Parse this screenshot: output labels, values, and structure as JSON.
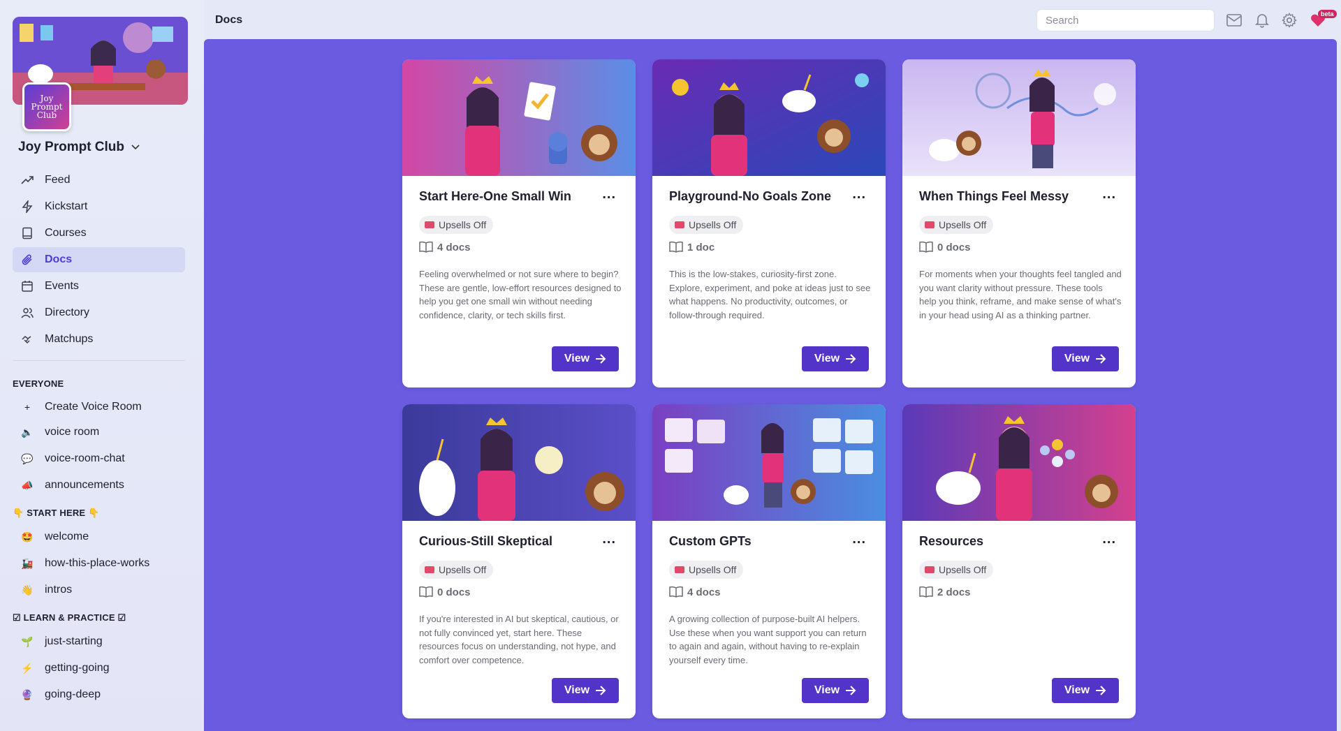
{
  "header": {
    "page_title": "Docs",
    "search_placeholder": "Search",
    "beta_badge": "beta"
  },
  "club": {
    "name": "Joy Prompt Club",
    "logo_text": "Joy Prompt Club"
  },
  "nav": [
    {
      "label": "Feed",
      "icon": "trending-icon"
    },
    {
      "label": "Kickstart",
      "icon": "lightning-icon"
    },
    {
      "label": "Courses",
      "icon": "book-icon"
    },
    {
      "label": "Docs",
      "icon": "paperclip-icon",
      "active": true
    },
    {
      "label": "Events",
      "icon": "calendar-icon"
    },
    {
      "label": "Directory",
      "icon": "users-icon"
    },
    {
      "label": "Matchups",
      "icon": "handshake-icon"
    }
  ],
  "sections": {
    "everyone": "EVERYONE",
    "start_here": "START HERE",
    "learn_practice": "LEARN & PRACTICE"
  },
  "everyone_channels": [
    {
      "label": "Create Voice Room",
      "icon": "+"
    },
    {
      "label": "voice room",
      "icon": "🔈"
    },
    {
      "label": "voice-room-chat",
      "icon": "💬"
    },
    {
      "label": "announcements",
      "icon": "📣"
    }
  ],
  "start_channels": [
    {
      "label": "welcome",
      "icon": "🤩"
    },
    {
      "label": "how-this-place-works",
      "icon": "🚂"
    },
    {
      "label": "intros",
      "icon": "👋"
    }
  ],
  "learn_channels": [
    {
      "label": "just-starting",
      "icon": "🌱"
    },
    {
      "label": "getting-going",
      "icon": "⚡"
    },
    {
      "label": "going-deep",
      "icon": "🔮"
    }
  ],
  "cards": [
    {
      "title": "Start Here-One Small Win",
      "badge": "Upsells Off",
      "docs": "4 docs",
      "desc": "Feeling overwhelmed or not sure where to begin? These are gentle, low-effort resources designed to help you get one small win without needing confidence, clarity, or tech skills first.",
      "view": "View"
    },
    {
      "title": "Playground-No Goals Zone",
      "badge": "Upsells Off",
      "docs": "1 doc",
      "desc": "This is the low-stakes, curiosity-first zone. Explore, experiment, and poke at ideas just to see what happens. No productivity, outcomes, or follow-through required.",
      "view": "View"
    },
    {
      "title": "When Things Feel Messy",
      "badge": "Upsells Off",
      "docs": "0 docs",
      "desc": "For moments when your thoughts feel tangled and you want clarity without pressure. These tools help you think, reframe, and make sense of what's in your head using AI as a thinking partner.",
      "view": "View"
    },
    {
      "title": "Curious-Still Skeptical",
      "badge": "Upsells Off",
      "docs": "0 docs",
      "desc": "If you're interested in AI but skeptical, cautious, or not fully convinced yet, start here. These resources focus on understanding, not hype, and comfort over competence.",
      "view": "View"
    },
    {
      "title": "Custom GPTs",
      "badge": "Upsells Off",
      "docs": "4 docs",
      "desc": "A growing collection of purpose-built AI helpers. Use these when you want support you can return to again and again, without having to re-explain yourself every time.",
      "view": "View"
    },
    {
      "title": "Resources",
      "badge": "Upsells Off",
      "docs": "2 docs",
      "desc": "",
      "view": "View"
    }
  ],
  "colors": {
    "main_bg": "#6a5be0",
    "button": "#5334c8",
    "active_nav": "#4c3ed6"
  }
}
